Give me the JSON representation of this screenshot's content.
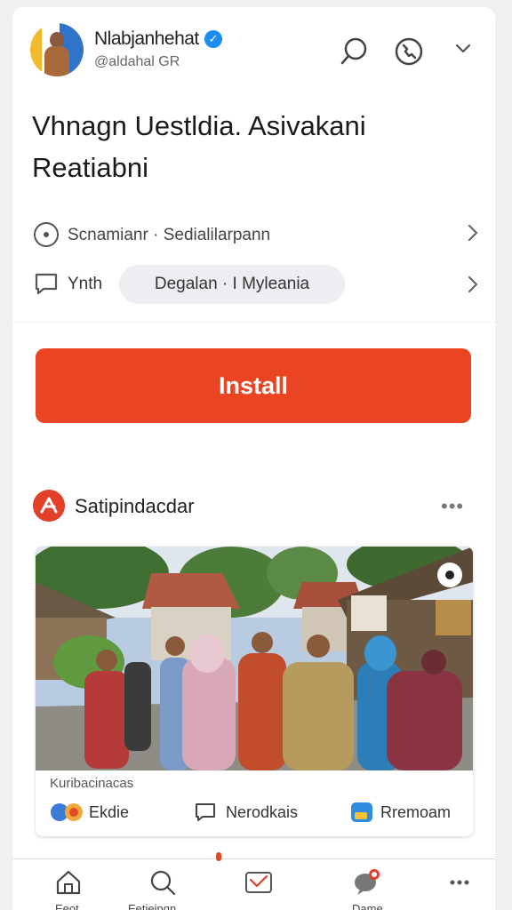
{
  "colors": {
    "accent": "#ea4523",
    "verified": "#1d8cf0",
    "chip_bg": "#eceef1",
    "page_bg": "#f0f0f2"
  },
  "header": {
    "user_name": "Nlabjanhehat",
    "user_handle": "@aldahal GR",
    "verified_icon": "check-badge-icon",
    "icons": [
      "search-icon",
      "call-icon",
      "chevron-down-icon"
    ]
  },
  "post": {
    "title": "Vhnagn Uestldia. Asivakani Reatiabni"
  },
  "meta": {
    "schedule_text": "Scnamianr · Sedialilarpann",
    "comment_label": "Ynth",
    "chip_text": "Degalan · I Myleania"
  },
  "install": {
    "label": "Install"
  },
  "section": {
    "title": "Satipindacdar",
    "more": "•••"
  },
  "photo_card": {
    "caption": "Kuribacinacas",
    "actions": [
      {
        "label": "Ekdie",
        "icon": "reaction-icon"
      },
      {
        "label": "Nerodkais",
        "icon": "comment-icon"
      },
      {
        "label": "Rremoam",
        "icon": "app-icon"
      }
    ]
  },
  "bottom_nav": [
    {
      "label": "Eeot",
      "icon": "home-icon"
    },
    {
      "label": "Eetieingn",
      "icon": "search-icon"
    },
    {
      "label": "",
      "icon": "mail-icon"
    },
    {
      "label": "Dame",
      "icon": "chat-icon"
    },
    {
      "label": "",
      "icon": "more-icon"
    }
  ]
}
